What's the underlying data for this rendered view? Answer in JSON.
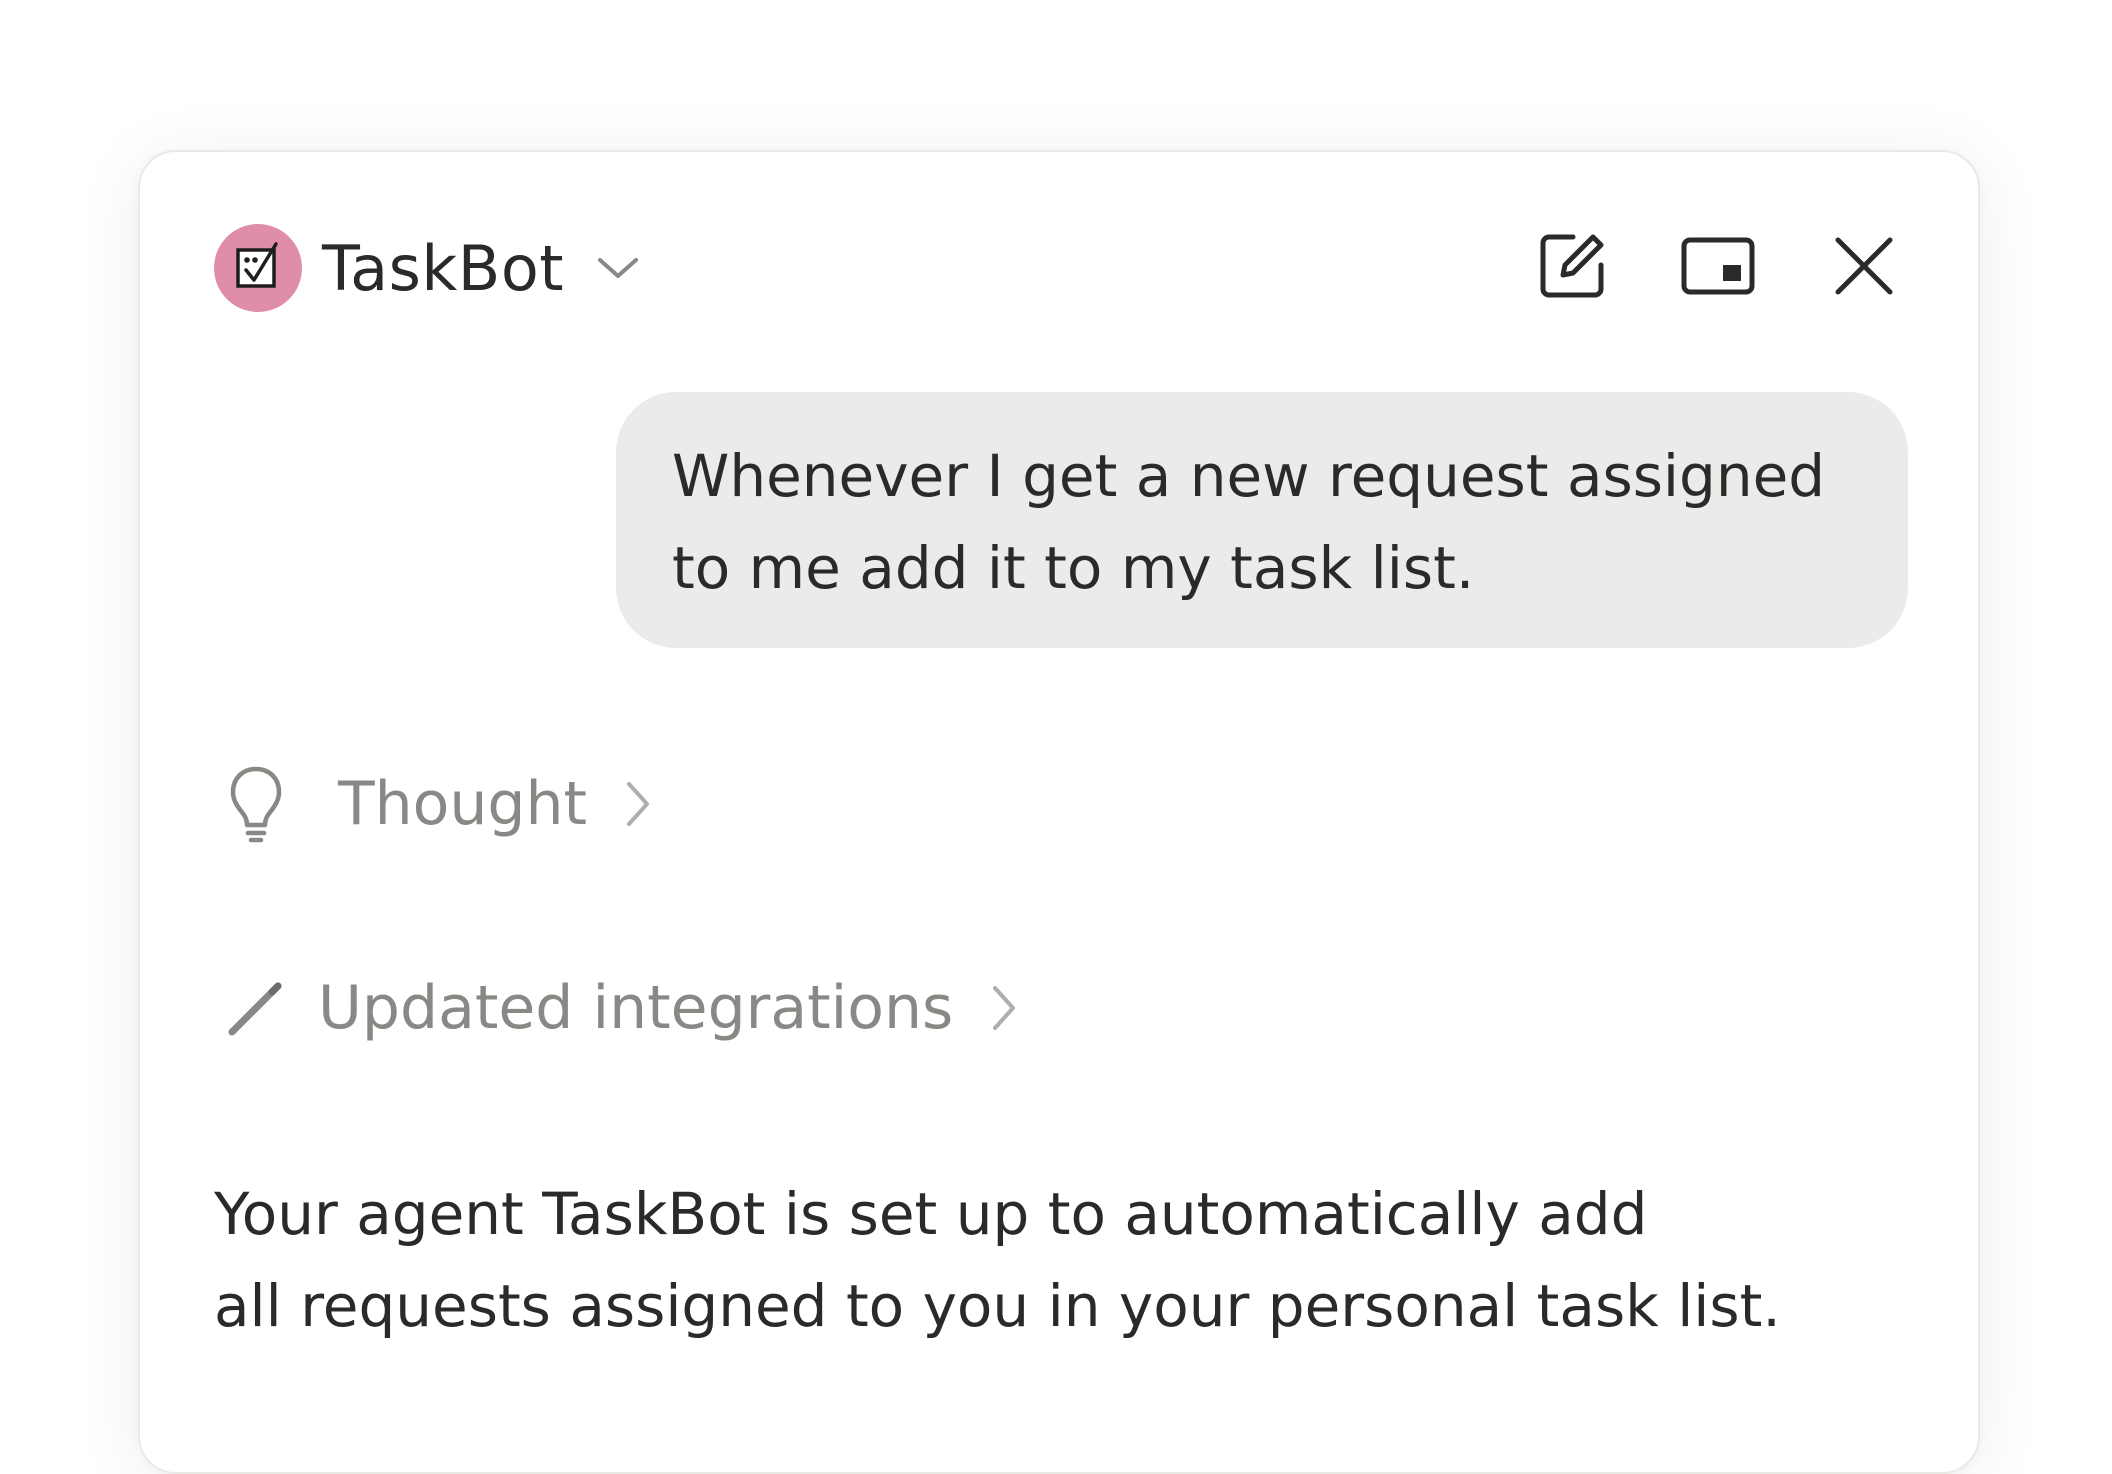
{
  "header": {
    "agent_name": "TaskBot",
    "agent_icon": "robot-task-icon",
    "avatar_color": "#e08cab",
    "actions": [
      {
        "name": "new-chat",
        "icon": "edit-square-icon"
      },
      {
        "name": "picture-in-picture",
        "icon": "pip-window-icon"
      },
      {
        "name": "close",
        "icon": "close-icon"
      }
    ]
  },
  "conversation": {
    "user_message": "Whenever I get a new request assigned to me add it to my task list.",
    "steps": [
      {
        "label": "Thought",
        "icon": "lightbulb-icon"
      },
      {
        "label": "Updated integrations",
        "icon": "pencil-icon"
      }
    ],
    "assistant_message_line1": "Your agent TaskBot is set up to automatically add",
    "assistant_message_line2": "all requests assigned to you in your personal task list."
  },
  "colors": {
    "text_primary": "#2b2a28",
    "text_muted": "#8a8884",
    "bubble_bg": "#ebebea",
    "avatar": "#e08cab"
  }
}
